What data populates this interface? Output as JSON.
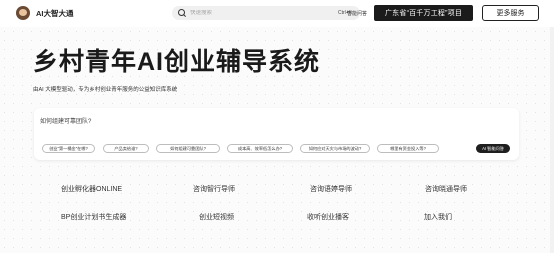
{
  "header": {
    "brand_name": "AI大智大通",
    "search_placeholder": "快速搜索",
    "search_shortcut": "Ctrl+K",
    "smart_qa_label": "智能问答",
    "project_button": "广东省“百千万工程”项目",
    "more_services_button": "更多服务"
  },
  "hero": {
    "title": "乡村青年AI创业辅导系统",
    "subtitle": "由AI 大模型驱动，专为乡村创业青年服务的公益知识库系统"
  },
  "qa": {
    "prompt": "如何组建可靠团队?",
    "chips": [
      "创业“第一桶金”在哪?",
      "产品卖给谁?",
      "如何组建可靠团队?",
      "成本高、效率低怎么办?",
      "如何应对天灾与市场的波动?",
      "哪里有资金投入等?"
    ],
    "ai_button": "AI 智能问答"
  },
  "links": {
    "row1": [
      "创业孵化器ONLINE",
      "咨询智行导师",
      "咨询语婷导师",
      "咨询晓通导师"
    ],
    "row2": [
      "BP创业计划书生成器",
      "创业短视频",
      "收听创业播客",
      "加入我们"
    ]
  },
  "icons": {
    "brand": "avatar-logo",
    "search": "search-icon"
  },
  "colors": {
    "primary_dark": "#1b1b1b",
    "background": "#fbfbfb"
  }
}
